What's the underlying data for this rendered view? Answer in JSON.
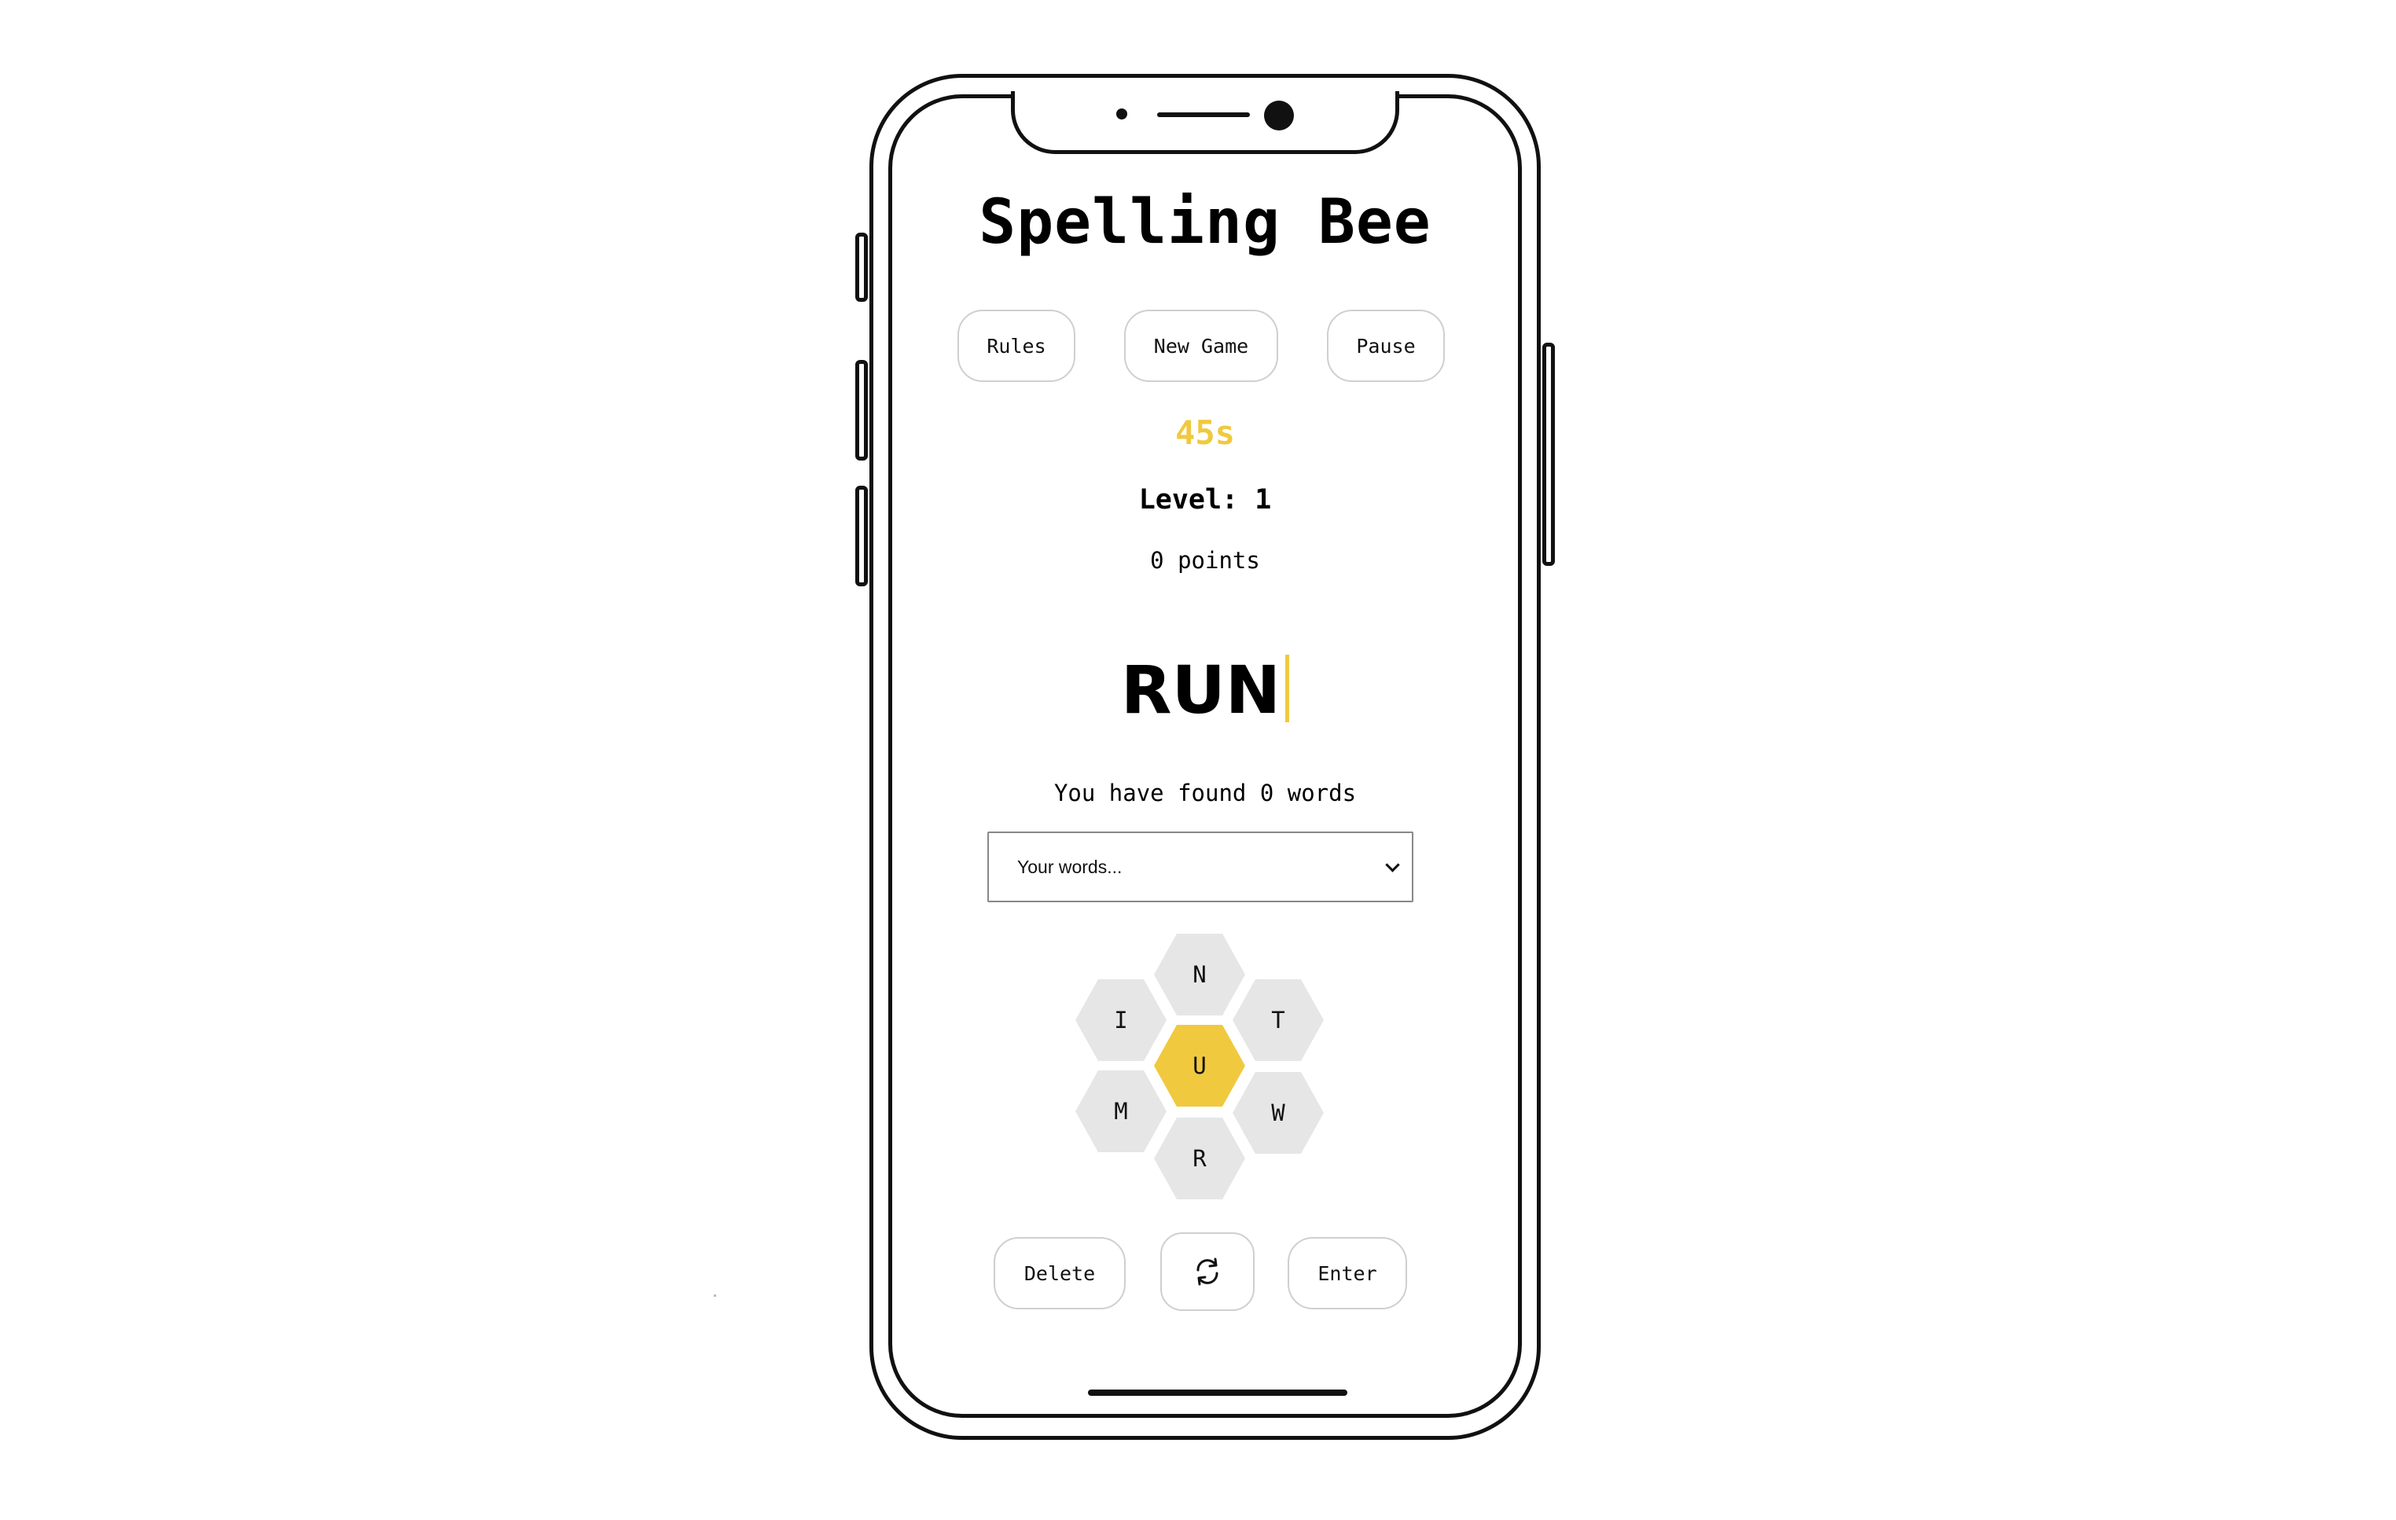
{
  "app": {
    "title": "Spelling Bee"
  },
  "controls": {
    "rules_label": "Rules",
    "new_game_label": "New Game",
    "pause_label": "Pause"
  },
  "status": {
    "timer": "45s",
    "level": "Level: 1",
    "points": "0 points"
  },
  "input": {
    "current_word": "RUN"
  },
  "words": {
    "found_text": "You have found 0 words",
    "dropdown_placeholder": "Your words..."
  },
  "letters": {
    "center": "U",
    "outer": [
      "N",
      "I",
      "T",
      "M",
      "W",
      "R"
    ]
  },
  "actions": {
    "delete_label": "Delete",
    "shuffle_icon": "refresh-icon",
    "enter_label": "Enter"
  },
  "colors": {
    "accent": "#f0c93f",
    "hex_gray": "#e6e6e6"
  }
}
